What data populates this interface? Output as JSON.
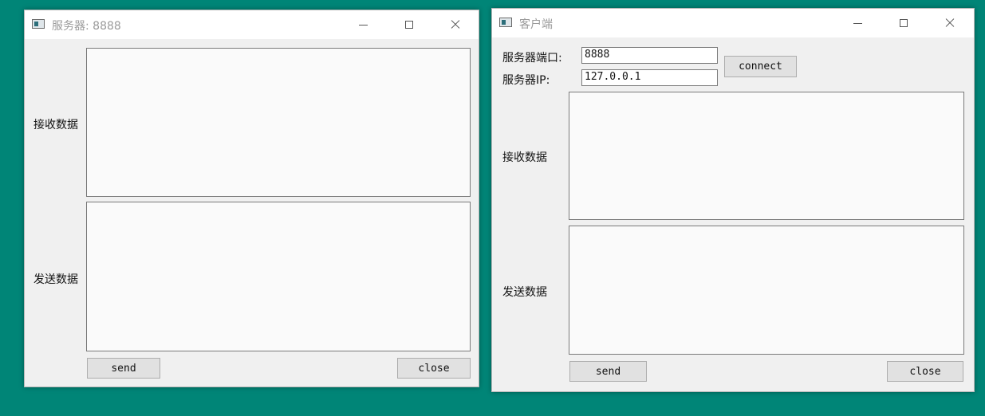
{
  "server": {
    "title": "服务器: 8888",
    "recv_label": "接收数据",
    "send_label": "发送数据",
    "send_button": "send",
    "close_button": "close"
  },
  "client": {
    "title": "客户端",
    "port_label": "服务器端口:",
    "port_value": "8888",
    "ip_label": "服务器IP:",
    "ip_value": "127.0.0.1",
    "connect_button": "connect",
    "recv_label": "接收数据",
    "send_label": "发送数据",
    "send_button": "send",
    "close_button": "close"
  },
  "colors": {
    "desktop": "#008577",
    "window_bg": "#f0f0f0",
    "titlebar": "#ffffff",
    "button": "#e1e1e1"
  },
  "icons": {
    "app": "window-app-icon",
    "minimize": "minimize-icon",
    "maximize": "maximize-icon",
    "close": "close-icon"
  }
}
